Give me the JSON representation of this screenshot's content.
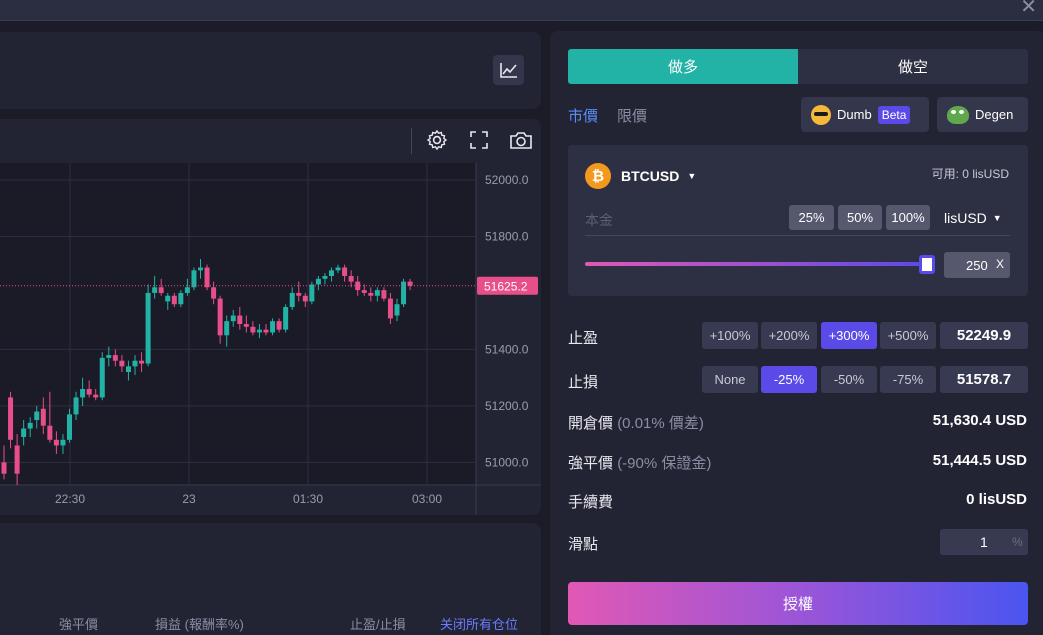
{
  "tabs": {
    "long": "做多",
    "short": "做空"
  },
  "order_types": {
    "market": "市價",
    "limit": "限價"
  },
  "modes": {
    "dumb": "Dumb",
    "beta": "Beta",
    "degen": "Degen"
  },
  "asset": {
    "symbol": "BTCUSD",
    "available": "可用: 0 lisUSD"
  },
  "principal": {
    "placeholder": "本金",
    "p25": "25%",
    "p50": "50%",
    "p100": "100%",
    "currency": "lisUSD"
  },
  "leverage": {
    "value": "250",
    "unit": "X",
    "fraction": 1.0
  },
  "take_profit": {
    "label": "止盈",
    "options": [
      "+100%",
      "+200%",
      "+300%",
      "+500%"
    ],
    "active_index": 2,
    "value": "52249.9"
  },
  "stop_loss": {
    "label": "止損",
    "options": [
      "None",
      "-25%",
      "-50%",
      "-75%"
    ],
    "active_index": 1,
    "value": "51578.7"
  },
  "open_price": {
    "label": "開倉價",
    "note": "(0.01% 價差)",
    "value": "51,630.4 USD"
  },
  "liq_price": {
    "label": "強平價",
    "note": "(-90% 保證金)",
    "value": "51,444.5 USD"
  },
  "fee": {
    "label": "手續費",
    "value": "0 lisUSD"
  },
  "slippage": {
    "label": "滑點",
    "value": "1",
    "unit": "%"
  },
  "authorize_label": "授權",
  "positions_table": {
    "liq_price": "強平價",
    "pnl": "損益 (報酬率%)",
    "tp_sl": "止盈/止損",
    "close_all": "关闭所有仓位"
  },
  "colors": {
    "up": "#22b3a6",
    "down": "#e84e8a",
    "accent": "#5a4ae8",
    "long_tab": "#22b3a6"
  },
  "icons": {
    "chart_type": "line-chart-icon",
    "settings": "gear-icon",
    "fullscreen": "fullscreen-icon",
    "screenshot": "camera-icon",
    "btc": "bitcoin-icon",
    "close": "close-icon"
  },
  "chart_data": {
    "type": "candlestick",
    "x_ticks": [
      "22:30",
      "23",
      "01:30",
      "03:00"
    ],
    "y_ticks": [
      "52000.0",
      "51800.0",
      "51400.0",
      "51200.0",
      "51000.0"
    ],
    "ylim": [
      50920,
      52060
    ],
    "last_price": "51625.2",
    "candles": [
      {
        "o": 51000,
        "h": 51060,
        "l": 50940,
        "c": 50960
      },
      {
        "o": 51230,
        "h": 51250,
        "l": 51050,
        "c": 51080
      },
      {
        "o": 51060,
        "h": 51100,
        "l": 50920,
        "c": 50960
      },
      {
        "o": 51090,
        "h": 51150,
        "l": 51060,
        "c": 51120
      },
      {
        "o": 51120,
        "h": 51160,
        "l": 51090,
        "c": 51140
      },
      {
        "o": 51150,
        "h": 51200,
        "l": 51120,
        "c": 51180
      },
      {
        "o": 51190,
        "h": 51230,
        "l": 51100,
        "c": 51130
      },
      {
        "o": 51130,
        "h": 51250,
        "l": 51070,
        "c": 51080
      },
      {
        "o": 51080,
        "h": 51110,
        "l": 51030,
        "c": 51060
      },
      {
        "o": 51060,
        "h": 51100,
        "l": 51030,
        "c": 51080
      },
      {
        "o": 51080,
        "h": 51190,
        "l": 51070,
        "c": 51170
      },
      {
        "o": 51170,
        "h": 51250,
        "l": 51150,
        "c": 51230
      },
      {
        "o": 51230,
        "h": 51300,
        "l": 51200,
        "c": 51260
      },
      {
        "o": 51260,
        "h": 51290,
        "l": 51230,
        "c": 51240
      },
      {
        "o": 51240,
        "h": 51260,
        "l": 51220,
        "c": 51230
      },
      {
        "o": 51230,
        "h": 51390,
        "l": 51220,
        "c": 51370
      },
      {
        "o": 51370,
        "h": 51410,
        "l": 51340,
        "c": 51380
      },
      {
        "o": 51380,
        "h": 51400,
        "l": 51340,
        "c": 51360
      },
      {
        "o": 51360,
        "h": 51380,
        "l": 51320,
        "c": 51340
      },
      {
        "o": 51320,
        "h": 51360,
        "l": 51290,
        "c": 51340
      },
      {
        "o": 51340,
        "h": 51380,
        "l": 51310,
        "c": 51360
      },
      {
        "o": 51360,
        "h": 51390,
        "l": 51320,
        "c": 51350
      },
      {
        "o": 51350,
        "h": 51630,
        "l": 51340,
        "c": 51600
      },
      {
        "o": 51600,
        "h": 51660,
        "l": 51580,
        "c": 51620
      },
      {
        "o": 51620,
        "h": 51650,
        "l": 51590,
        "c": 51600
      },
      {
        "o": 51570,
        "h": 51600,
        "l": 51540,
        "c": 51590
      },
      {
        "o": 51590,
        "h": 51600,
        "l": 51550,
        "c": 51560
      },
      {
        "o": 51560,
        "h": 51610,
        "l": 51550,
        "c": 51600
      },
      {
        "o": 51600,
        "h": 51650,
        "l": 51590,
        "c": 51620
      },
      {
        "o": 51620,
        "h": 51690,
        "l": 51610,
        "c": 51680
      },
      {
        "o": 51680,
        "h": 51720,
        "l": 51650,
        "c": 51690
      },
      {
        "o": 51690,
        "h": 51700,
        "l": 51610,
        "c": 51620
      },
      {
        "o": 51620,
        "h": 51640,
        "l": 51560,
        "c": 51580
      },
      {
        "o": 51580,
        "h": 51590,
        "l": 51420,
        "c": 51450
      },
      {
        "o": 51450,
        "h": 51520,
        "l": 51410,
        "c": 51500
      },
      {
        "o": 51500,
        "h": 51540,
        "l": 51480,
        "c": 51520
      },
      {
        "o": 51520,
        "h": 51550,
        "l": 51470,
        "c": 51490
      },
      {
        "o": 51490,
        "h": 51520,
        "l": 51460,
        "c": 51480
      },
      {
        "o": 51480,
        "h": 51500,
        "l": 51450,
        "c": 51460
      },
      {
        "o": 51460,
        "h": 51490,
        "l": 51440,
        "c": 51470
      },
      {
        "o": 51470,
        "h": 51490,
        "l": 51450,
        "c": 51460
      },
      {
        "o": 51460,
        "h": 51510,
        "l": 51450,
        "c": 51500
      },
      {
        "o": 51500,
        "h": 51510,
        "l": 51460,
        "c": 51470
      },
      {
        "o": 51470,
        "h": 51560,
        "l": 51460,
        "c": 51550
      },
      {
        "o": 51550,
        "h": 51620,
        "l": 51540,
        "c": 51600
      },
      {
        "o": 51600,
        "h": 51640,
        "l": 51570,
        "c": 51590
      },
      {
        "o": 51590,
        "h": 51600,
        "l": 51550,
        "c": 51570
      },
      {
        "o": 51570,
        "h": 51640,
        "l": 51560,
        "c": 51630
      },
      {
        "o": 51630,
        "h": 51660,
        "l": 51610,
        "c": 51650
      },
      {
        "o": 51650,
        "h": 51670,
        "l": 51630,
        "c": 51660
      },
      {
        "o": 51660,
        "h": 51690,
        "l": 51640,
        "c": 51680
      },
      {
        "o": 51680,
        "h": 51700,
        "l": 51670,
        "c": 51690
      },
      {
        "o": 51690,
        "h": 51700,
        "l": 51640,
        "c": 51660
      },
      {
        "o": 51660,
        "h": 51680,
        "l": 51620,
        "c": 51640
      },
      {
        "o": 51640,
        "h": 51660,
        "l": 51590,
        "c": 51610
      },
      {
        "o": 51610,
        "h": 51630,
        "l": 51590,
        "c": 51600
      },
      {
        "o": 51600,
        "h": 51620,
        "l": 51570,
        "c": 51590
      },
      {
        "o": 51590,
        "h": 51620,
        "l": 51570,
        "c": 51610
      },
      {
        "o": 51610,
        "h": 51620,
        "l": 51570,
        "c": 51580
      },
      {
        "o": 51580,
        "h": 51600,
        "l": 51490,
        "c": 51510
      },
      {
        "o": 51520,
        "h": 51580,
        "l": 51500,
        "c": 51560
      },
      {
        "o": 51560,
        "h": 51650,
        "l": 51550,
        "c": 51640
      },
      {
        "o": 51640,
        "h": 51650,
        "l": 51610,
        "c": 51625
      }
    ]
  }
}
